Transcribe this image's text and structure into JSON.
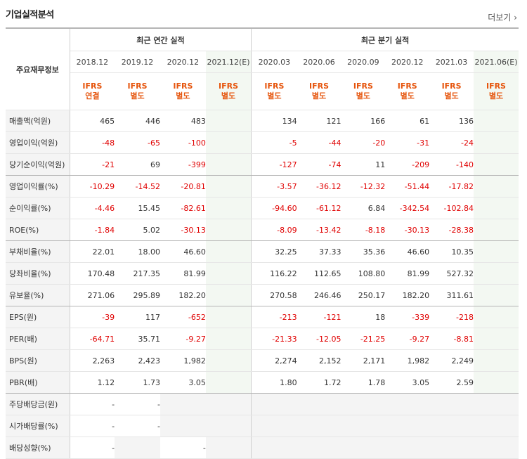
{
  "section_title": "기업실적분석",
  "more_label": "더보기",
  "corner_label": "주요재무정보",
  "annual_group": "최근 연간 실적",
  "quarter_group": "최근 분기 실적",
  "periods": [
    "2018.12",
    "2019.12",
    "2020.12",
    "2021.12(E)",
    "2020.03",
    "2020.06",
    "2020.09",
    "2020.12",
    "2021.03",
    "2021.06(E)"
  ],
  "standards": [
    [
      "IFRS",
      "연결"
    ],
    [
      "IFRS",
      "별도"
    ],
    [
      "IFRS",
      "별도"
    ],
    [
      "IFRS",
      "별도"
    ],
    [
      "IFRS",
      "별도"
    ],
    [
      "IFRS",
      "별도"
    ],
    [
      "IFRS",
      "별도"
    ],
    [
      "IFRS",
      "별도"
    ],
    [
      "IFRS",
      "별도"
    ],
    [
      "IFRS",
      "별도"
    ]
  ],
  "rows": [
    {
      "label": "매출액(억원)",
      "values": [
        "465",
        "446",
        "483",
        "",
        "134",
        "121",
        "166",
        "61",
        "136",
        ""
      ]
    },
    {
      "label": "영업이익(억원)",
      "values": [
        "-48",
        "-65",
        "-100",
        "",
        "-5",
        "-44",
        "-20",
        "-31",
        "-24",
        ""
      ]
    },
    {
      "label": "당기순이익(억원)",
      "values": [
        "-21",
        "69",
        "-399",
        "",
        "-127",
        "-74",
        "11",
        "-209",
        "-140",
        ""
      ]
    },
    {
      "label": "영업이익률(%)",
      "values": [
        "-10.29",
        "-14.52",
        "-20.81",
        "",
        "-3.57",
        "-36.12",
        "-12.32",
        "-51.44",
        "-17.82",
        ""
      ]
    },
    {
      "label": "순이익률(%)",
      "values": [
        "-4.46",
        "15.45",
        "-82.61",
        "",
        "-94.60",
        "-61.12",
        "6.84",
        "-342.54",
        "-102.84",
        ""
      ]
    },
    {
      "label": "ROE(%)",
      "values": [
        "-1.84",
        "5.02",
        "-30.13",
        "",
        "-8.09",
        "-13.42",
        "-8.18",
        "-30.13",
        "-28.38",
        ""
      ]
    },
    {
      "label": "부채비율(%)",
      "values": [
        "22.01",
        "18.00",
        "46.60",
        "",
        "32.25",
        "37.33",
        "35.36",
        "46.60",
        "10.35",
        ""
      ]
    },
    {
      "label": "당좌비율(%)",
      "values": [
        "170.48",
        "217.35",
        "81.99",
        "",
        "116.22",
        "112.65",
        "108.80",
        "81.99",
        "527.32",
        ""
      ]
    },
    {
      "label": "유보율(%)",
      "values": [
        "271.06",
        "295.89",
        "182.20",
        "",
        "270.58",
        "246.46",
        "250.17",
        "182.20",
        "311.61",
        ""
      ]
    },
    {
      "label": "EPS(원)",
      "values": [
        "-39",
        "117",
        "-652",
        "",
        "-213",
        "-121",
        "18",
        "-339",
        "-218",
        ""
      ]
    },
    {
      "label": "PER(배)",
      "values": [
        "-64.71",
        "35.71",
        "-9.27",
        "",
        "-21.33",
        "-12.05",
        "-21.25",
        "-9.27",
        "-8.81",
        ""
      ]
    },
    {
      "label": "BPS(원)",
      "values": [
        "2,263",
        "2,423",
        "1,982",
        "",
        "2,274",
        "2,152",
        "2,171",
        "1,982",
        "2,249",
        ""
      ]
    },
    {
      "label": "PBR(배)",
      "values": [
        "1.12",
        "1.73",
        "3.05",
        "",
        "1.80",
        "1.72",
        "1.78",
        "3.05",
        "2.59",
        ""
      ]
    },
    {
      "label": "주당배당금(원)",
      "values": [
        "-",
        "-",
        "",
        "",
        "",
        "",
        "",
        "",
        "",
        ""
      ]
    },
    {
      "label": "시가배당률(%)",
      "values": [
        "-",
        "-",
        "",
        "",
        "",
        "",
        "",
        "",
        "",
        ""
      ]
    },
    {
      "label": "배당성향(%)",
      "values": [
        "-",
        "",
        "-",
        "",
        "",
        "",
        "",
        "",
        "",
        ""
      ]
    }
  ]
}
